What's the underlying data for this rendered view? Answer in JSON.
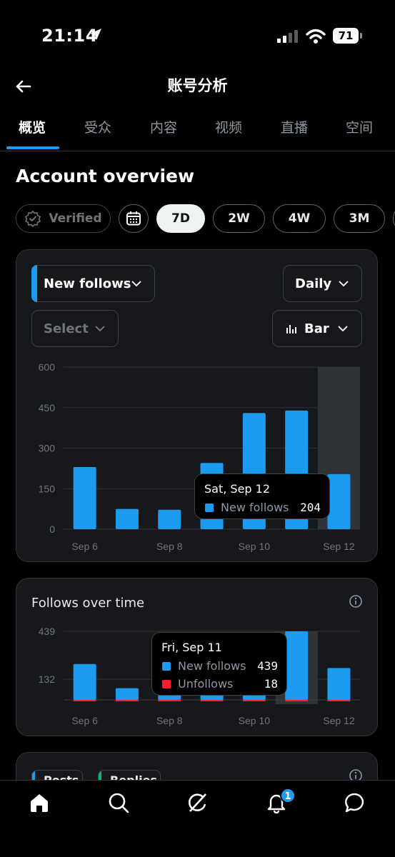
{
  "status_bar": {
    "time": "21:14",
    "battery": "71"
  },
  "header": {
    "title": "账号分析"
  },
  "tabs": [
    {
      "label": "概览",
      "active": true
    },
    {
      "label": "受众"
    },
    {
      "label": "内容"
    },
    {
      "label": "视频"
    },
    {
      "label": "直播"
    },
    {
      "label": "空间"
    }
  ],
  "overview": {
    "title": "Account overview",
    "chips": [
      {
        "label": "Verified",
        "state": "disabled"
      },
      {
        "label": "7D",
        "active": true
      },
      {
        "label": "2W"
      },
      {
        "label": "4W"
      },
      {
        "label": "3M"
      }
    ]
  },
  "metric_card": {
    "metric_select": "New follows",
    "granularity_select": "Daily",
    "compare_select": "Select",
    "chart_type_select": "Bar",
    "tooltip": {
      "title": "Sat, Sep 12",
      "series": "New follows",
      "value": "204"
    }
  },
  "follows_card": {
    "title": "Follows over time",
    "tooltip": {
      "title": "Fri, Sep 11",
      "rows": [
        {
          "series": "New follows",
          "value": "439"
        },
        {
          "series": "Unfollows",
          "value": "18"
        }
      ]
    }
  },
  "posts_card": {
    "pills": [
      "Posts",
      "Replies"
    ]
  },
  "bottom_nav": {
    "notification_count": "1"
  },
  "colors": {
    "accent": "#1d9bf0",
    "unfollows": "#f4212e",
    "replies": "#00ba7c",
    "card_bg": "#16181c",
    "highlight_band": "#2f3336"
  },
  "chart_data": [
    {
      "type": "bar",
      "categories": [
        "Sep 6",
        "Sep 7",
        "Sep 8",
        "Sep 9",
        "Sep 10",
        "Sep 11",
        "Sep 12"
      ],
      "x_tick_labels": [
        "Sep 6",
        "Sep 8",
        "Sep 10",
        "Sep 12"
      ],
      "series": [
        {
          "name": "New follows",
          "values": [
            230,
            75,
            72,
            245,
            430,
            439,
            204
          ]
        }
      ],
      "ylim": [
        0,
        600
      ],
      "y_ticks": [
        0,
        150,
        300,
        450,
        600
      ],
      "highlighted_category": "Sep 12",
      "grid": true
    },
    {
      "type": "bar",
      "categories": [
        "Sep 6",
        "Sep 7",
        "Sep 8",
        "Sep 9",
        "Sep 10",
        "Sep 11",
        "Sep 12"
      ],
      "x_tick_labels": [
        "Sep 6",
        "Sep 8",
        "Sep 10",
        "Sep 12"
      ],
      "series": [
        {
          "name": "New follows",
          "values": [
            230,
            75,
            72,
            245,
            430,
            439,
            204
          ]
        },
        {
          "name": "Unfollows",
          "values": [
            10,
            8,
            9,
            11,
            12,
            18,
            9
          ]
        }
      ],
      "y_ticks": [
        132,
        439
      ],
      "highlighted_category": "Sep 11",
      "grid": true
    }
  ]
}
